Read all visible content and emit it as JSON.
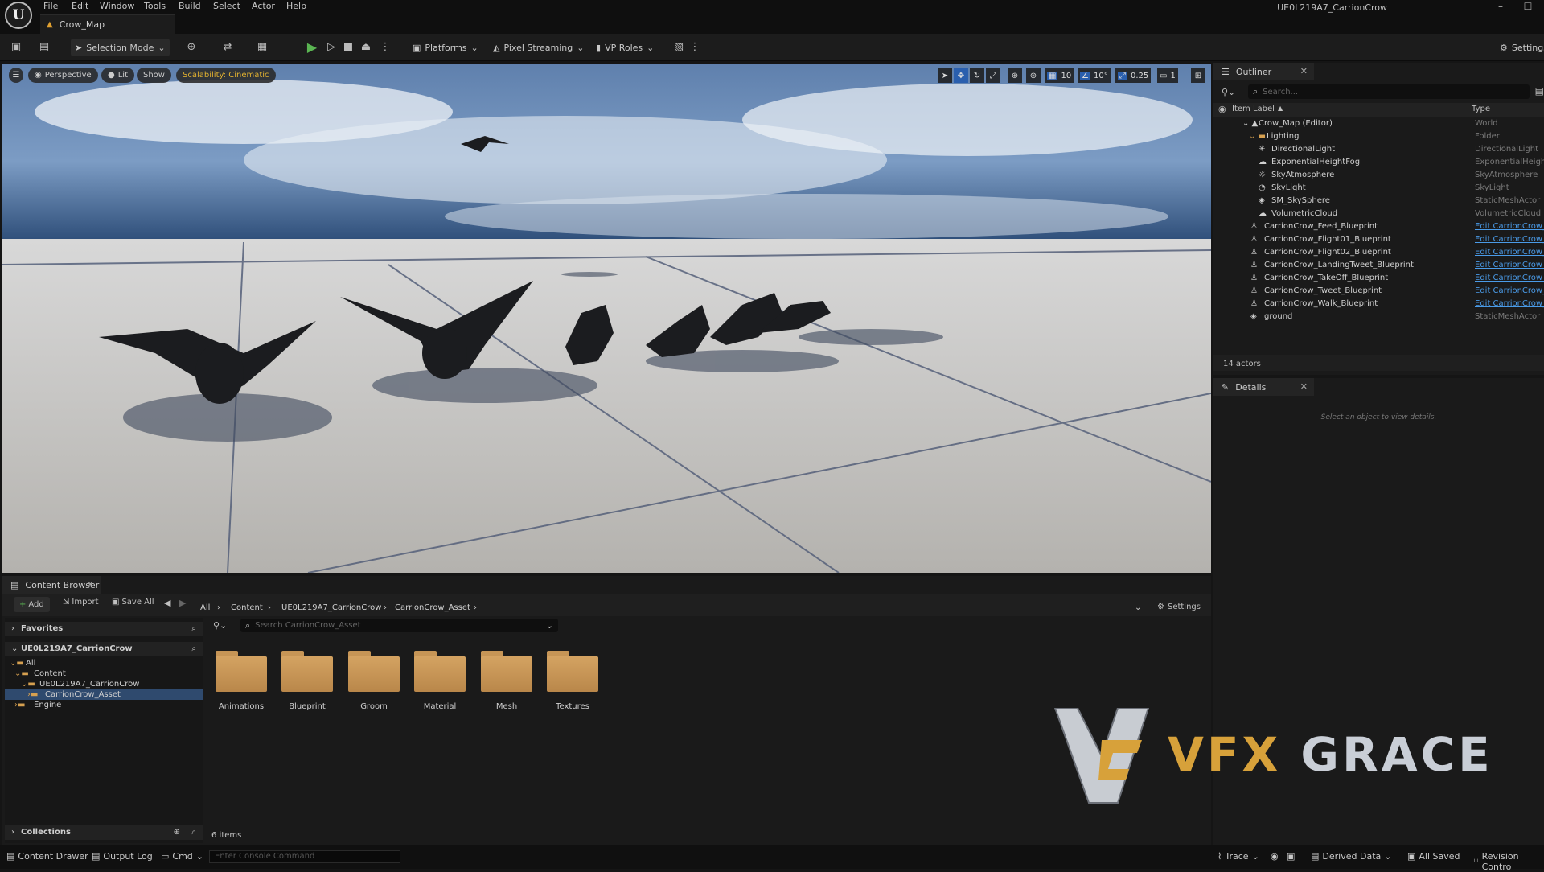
{
  "menubar": {
    "items": [
      "File",
      "Edit",
      "Window",
      "Tools",
      "Build",
      "Select",
      "Actor",
      "Help"
    ],
    "map_tab": "Crow_Map",
    "project_name": "UE0L219A7_CarrionCrow"
  },
  "toolbar": {
    "selection_mode": "Selection Mode",
    "platforms": "Platforms",
    "pixel_streaming": "Pixel Streaming",
    "vp_roles": "VP Roles",
    "settings": "Settings"
  },
  "viewport": {
    "perspective": "Perspective",
    "lit": "Lit",
    "show": "Show",
    "scalability": "Scalability: Cinematic",
    "grid_snap": "10",
    "rot_snap": "10°",
    "scale_snap": "0.25",
    "camera_speed": "1"
  },
  "outliner": {
    "title": "Outliner",
    "search_placeholder": "Search...",
    "col_label": "Item Label",
    "col_type": "Type",
    "rows": [
      {
        "label": "Crow_Map (Editor)",
        "type": "World"
      },
      {
        "label": "Lighting",
        "type": "Folder"
      },
      {
        "label": "DirectionalLight",
        "type": "DirectionalLight"
      },
      {
        "label": "ExponentialHeightFog",
        "type": "ExponentialHeightF"
      },
      {
        "label": "SkyAtmosphere",
        "type": "SkyAtmosphere"
      },
      {
        "label": "SkyLight",
        "type": "SkyLight"
      },
      {
        "label": "SM_SkySphere",
        "type": "StaticMeshActor"
      },
      {
        "label": "VolumetricCloud",
        "type": "VolumetricCloud"
      },
      {
        "label": "CarrionCrow_Feed_Blueprint",
        "type": "Edit CarrionCrow_F"
      },
      {
        "label": "CarrionCrow_Flight01_Blueprint",
        "type": "Edit CarrionCrow_F"
      },
      {
        "label": "CarrionCrow_Flight02_Blueprint",
        "type": "Edit CarrionCrow_F"
      },
      {
        "label": "CarrionCrow_LandingTweet_Blueprint",
        "type": "Edit CarrionCrow_L"
      },
      {
        "label": "CarrionCrow_TakeOff_Blueprint",
        "type": "Edit CarrionCrow_T"
      },
      {
        "label": "CarrionCrow_Tweet_Blueprint",
        "type": "Edit CarrionCrow_T"
      },
      {
        "label": "CarrionCrow_Walk_Blueprint",
        "type": "Edit CarrionCrow_W"
      },
      {
        "label": "ground",
        "type": "StaticMeshActor"
      }
    ],
    "actor_count": "14 actors"
  },
  "details": {
    "title": "Details",
    "empty_msg": "Select an object to view details."
  },
  "content_browser": {
    "title": "Content Browser",
    "add": "Add",
    "import": "Import",
    "save_all": "Save All",
    "breadcrumb": [
      "All",
      "Content",
      "UE0L219A7_CarrionCrow",
      "CarrionCrow_Asset"
    ],
    "settings": "Settings",
    "favorites": "Favorites",
    "project_root": "UE0L219A7_CarrionCrow",
    "tree": [
      "All",
      "Content",
      "UE0L219A7_CarrionCrow",
      "CarrionCrow_Asset",
      "Engine"
    ],
    "search_placeholder": "Search CarrionCrow_Asset",
    "folders": [
      "Animations",
      "Blueprint",
      "Groom",
      "Material",
      "Mesh",
      "Textures"
    ],
    "item_count": "6 items",
    "collections": "Collections"
  },
  "statusbar": {
    "content_drawer": "Content Drawer",
    "output_log": "Output Log",
    "cmd": "Cmd",
    "console_placeholder": "Enter Console Command",
    "trace": "Trace",
    "derived_data": "Derived Data",
    "all_saved": "All Saved",
    "revision_control": "Revision Contro"
  },
  "watermark": {
    "text": "VFX GRACE"
  },
  "colors": {
    "link": "#4a9be8",
    "scalability": "#e0b030",
    "play": "#5ab552",
    "folder": "#c69556"
  }
}
